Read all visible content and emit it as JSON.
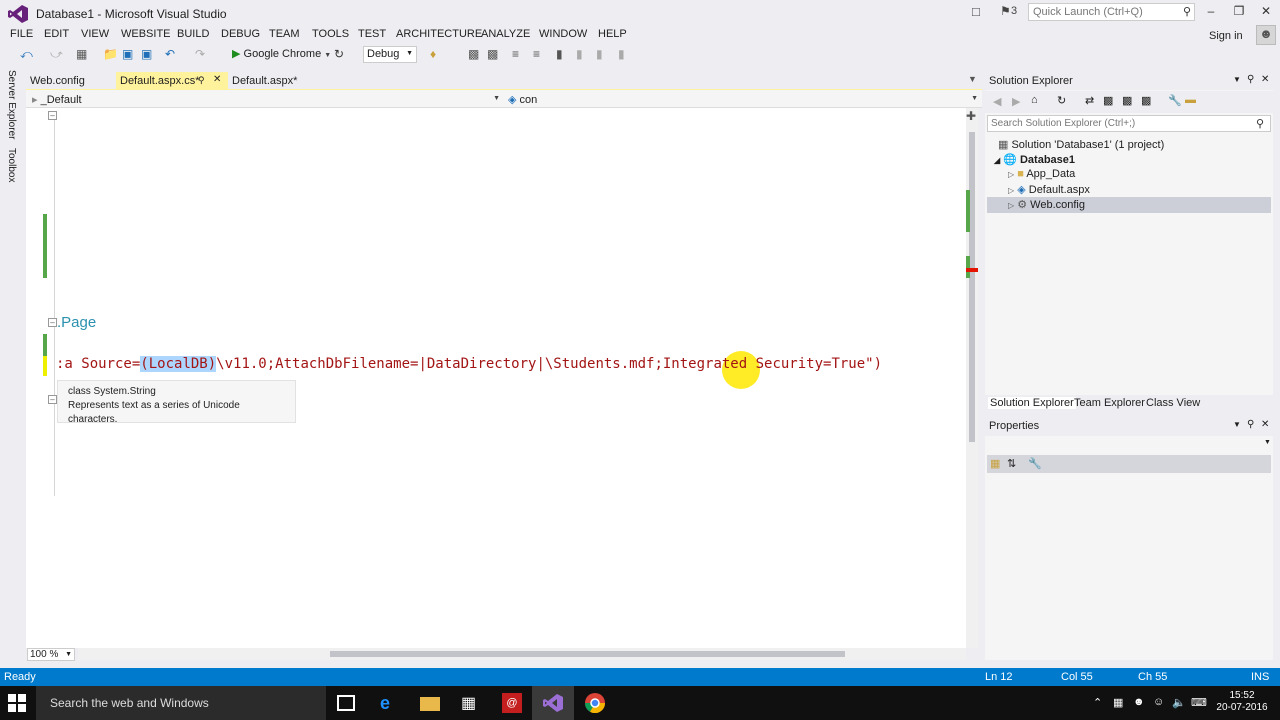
{
  "window": {
    "title": "Database1 - Microsoft Visual Studio",
    "flag_count": "3",
    "quick_launch_placeholder": "Quick Launch (Ctrl+Q)",
    "sign_in": "Sign in"
  },
  "menu": [
    "FILE",
    "EDIT",
    "VIEW",
    "WEBSITE",
    "BUILD",
    "DEBUG",
    "TEAM",
    "TOOLS",
    "TEST",
    "ARCHITECTURE",
    "ANALYZE",
    "WINDOW",
    "HELP"
  ],
  "toolbar": {
    "run_target": "Google Chrome",
    "configuration": "Debug"
  },
  "side_tabs": [
    "Server Explorer",
    "Toolbox"
  ],
  "doc_tabs": [
    {
      "label": "Web.config",
      "active": false
    },
    {
      "label": "Default.aspx.cs*",
      "active": true
    },
    {
      "label": "Default.aspx*",
      "active": false
    }
  ],
  "navbar": {
    "class_dropdown": "_Default",
    "member_dropdown": "con"
  },
  "editor": {
    "page_text": ".Page",
    "code_line_prefix": ":a Source=",
    "code_line_highlight": "(LocalDB)",
    "code_line_suffix": "\\v11.0;AttachDbFilename=|DataDirectory|\\Students.mdf;Integrated Security=True\")",
    "tooltip_line1": "class System.String",
    "tooltip_line2": "Represents text as a series of Unicode characters.",
    "zoom": "100 %"
  },
  "solution_explorer": {
    "title": "Solution Explorer",
    "search_placeholder": "Search Solution Explorer (Ctrl+;)",
    "solution": "Solution 'Database1' (1 project)",
    "project": "Database1",
    "items": [
      "App_Data",
      "Default.aspx",
      "Web.config"
    ],
    "tabs": [
      "Solution Explorer",
      "Team Explorer",
      "Class View"
    ]
  },
  "properties": {
    "title": "Properties"
  },
  "statusbar": {
    "state": "Ready",
    "line": "Ln 12",
    "col": "Col 55",
    "ch": "Ch 55",
    "mode": "INS"
  },
  "taskbar": {
    "search": "Search the web and Windows",
    "time": "15:52",
    "date": "20-07-2016"
  },
  "colors": {
    "statusbar": "#007acc",
    "active_tab": "#fff29d",
    "selection": "#add6ff",
    "cursor_highlight": "#ffe700",
    "string_literal": "#a31515",
    "type_name": "#2b91af"
  }
}
